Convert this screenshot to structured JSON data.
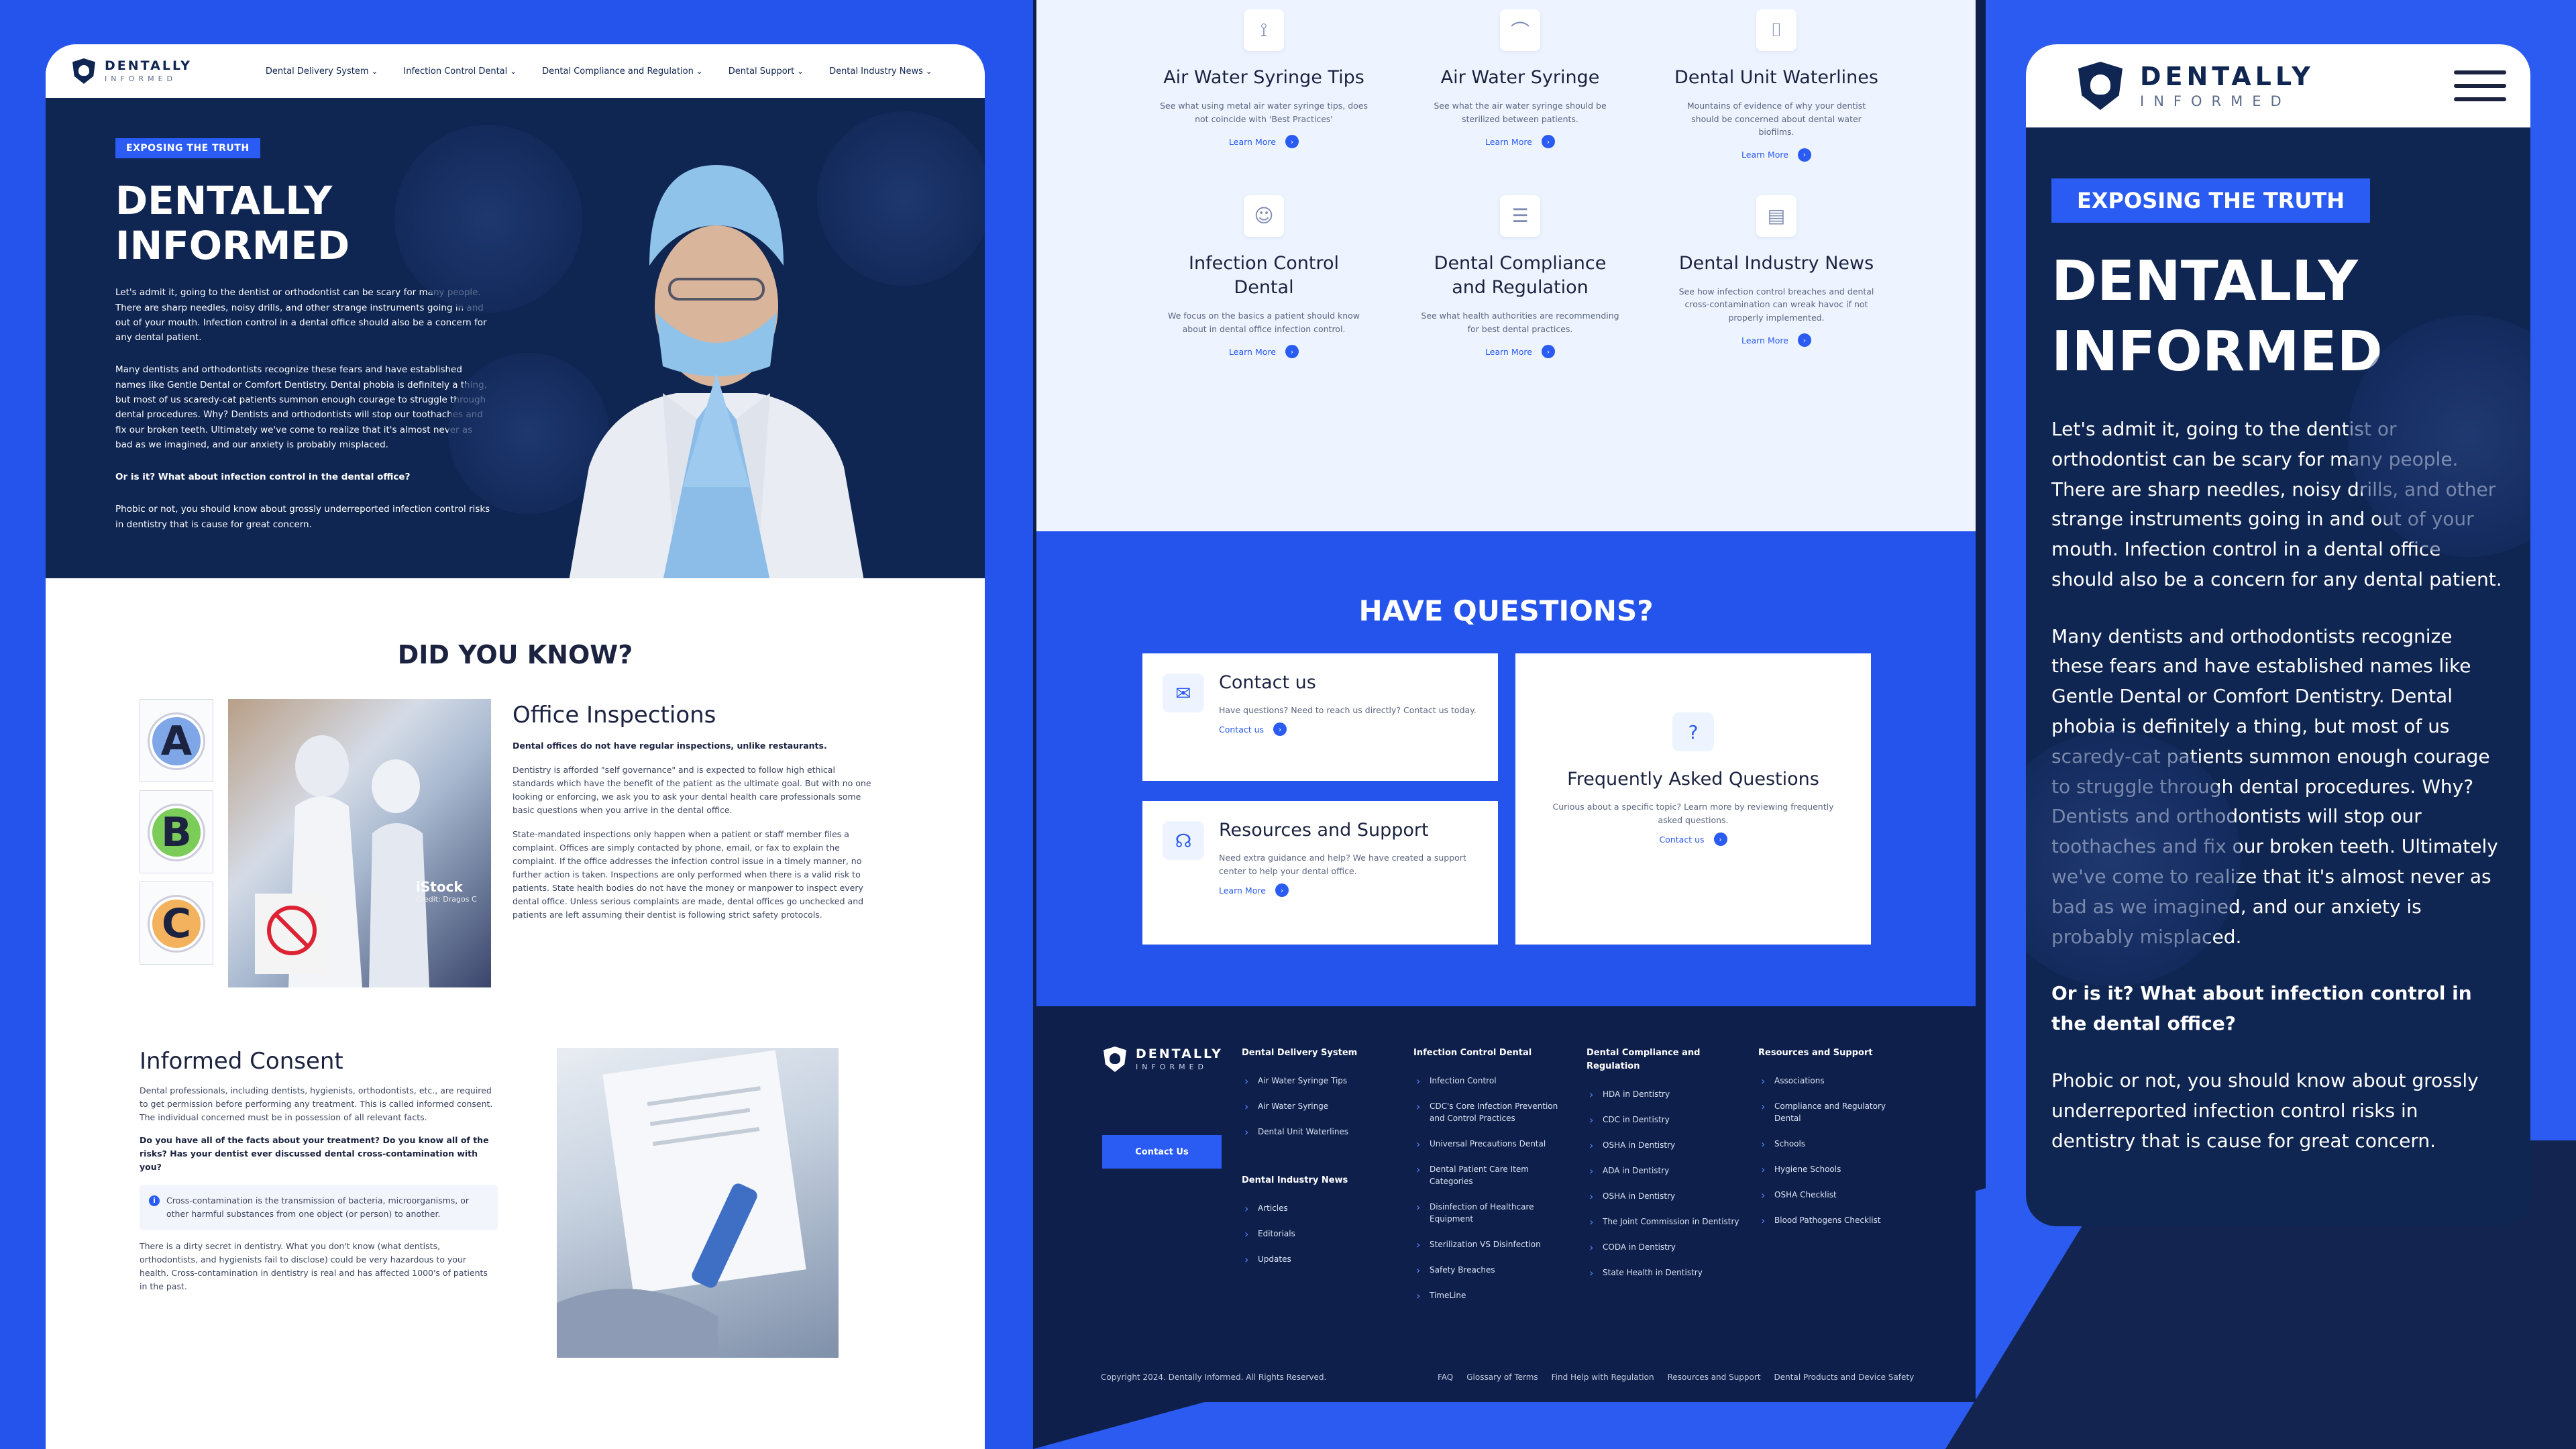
{
  "brand": {
    "name": "DENTALLY",
    "sub": "INFORMED"
  },
  "nav": {
    "items": [
      "Dental Delivery System",
      "Infection Control Dental",
      "Dental Compliance and Regulation",
      "Dental Support",
      "Dental Industry News"
    ]
  },
  "hero": {
    "tag": "EXPOSING THE TRUTH",
    "title_line1": "DENTALLY",
    "title_line2": "INFORMED",
    "p1": "Let's admit it, going to the dentist or orthodontist can be scary for many people. There are sharp needles, noisy drills, and other strange instruments going in and out of your mouth. Infection control in a dental office should also be a concern for any dental patient.",
    "p2": "Many dentists and orthodontists recognize these fears and have established names like Gentle Dental or Comfort Dentistry. Dental phobia is definitely a thing, but most of us scaredy-cat patients summon enough courage to struggle through dental procedures. Why? Dentists and orthodontists will stop our toothaches and fix our broken teeth. Ultimately we've come to realize that it's almost never as bad as we imagined, and our anxiety is probably misplaced.",
    "p3": "Or is it? What about infection control in the dental office?",
    "p4": "Phobic or not, you should know about grossly underreported infection control risks in dentistry that is cause for great concern."
  },
  "did_you_know": {
    "title": "DID YOU KNOW?",
    "grades": [
      "A",
      "B",
      "C"
    ],
    "photo_watermark": "iStock",
    "photo_credit": "Credit: Dragos C",
    "office": {
      "title": "Office Inspections",
      "lead": "Dental offices do not have regular inspections, unlike restaurants.",
      "p1": "Dentistry is afforded \"self governance\" and is expected to follow high ethical standards which have the benefit of the patient as the ultimate goal. But with no one looking or enforcing, we ask you to ask your dental health care professionals some basic questions when you arrive in the dental office.",
      "p2": "State-mandated inspections only happen when a patient or staff member files a complaint. Offices are simply contacted by phone, email, or fax to explain the complaint. If the office addresses the infection control issue in a timely manner, no further action is taken. Inspections are only performed when there is a valid risk to patients. State health bodies do not have the money or manpower to inspect every dental office. Unless serious complaints are made, dental offices go unchecked and patients are left assuming their dentist is following strict safety protocols."
    },
    "consent": {
      "title": "Informed Consent",
      "p1": "Dental professionals, including dentists, hygienists, orthodontists, etc., are required to get permission before performing any treatment. This is called informed consent. The individual concerned must be in possession of all relevant facts.",
      "q": "Do you have all of the facts about your treatment? Do you know all of the risks? Has your dentist ever discussed dental cross-contamination with you?",
      "callout": "Cross-contamination is the transmission of bacteria, microorganisms, or other harmful substances from one object (or person) to another.",
      "p2": "There is a dirty secret in dentistry. What you don't know (what dentists, orthodontists, and hygienists fail to disclose) could be very hazardous to your health. Cross-contamination in dentistry is real and has affected 1000's of patients in the past."
    }
  },
  "cards": [
    {
      "icon": "syringe-icon",
      "glyph": "⟟",
      "title": "Air Water Syringe Tips",
      "text": "See what using metal air water syringe tips, does not coincide with 'Best Practices'",
      "link": "Learn More"
    },
    {
      "icon": "syringe-hose-icon",
      "glyph": "⌒",
      "title": "Air Water Syringe",
      "text": "See what the air water syringe should be sterilized between patients.",
      "link": "Learn More"
    },
    {
      "icon": "water-bottle-icon",
      "glyph": "⌷",
      "title": "Dental Unit Waterlines",
      "text": "Mountains of evidence of why your dentist should be concerned about dental water biofilms.",
      "link": "Learn More"
    },
    {
      "icon": "dentist-icon",
      "glyph": "☺",
      "title": "Infection Control Dental",
      "text": "We focus on the basics a patient should know about in dental office infection control.",
      "link": "Learn More"
    },
    {
      "icon": "clipboard-icon",
      "glyph": "☰",
      "title": "Dental Compliance and Regulation",
      "text": "See what health authorities are recommending for best dental practices.",
      "link": "Learn More"
    },
    {
      "icon": "newspaper-icon",
      "glyph": "▤",
      "title": "Dental Industry News",
      "text": "See how infection control breaches and dental cross-contamination can wreak havoc if not properly implemented.",
      "link": "Learn More"
    }
  ],
  "questions": {
    "title": "HAVE QUESTIONS?",
    "contact": {
      "title": "Contact us",
      "text": "Have questions? Need to reach us directly? Contact us today.",
      "link": "Contact us"
    },
    "resources": {
      "title": "Resources and Support",
      "text": "Need extra guidance and help? We have created a support center to help your dental office.",
      "link": "Learn More"
    },
    "faq": {
      "title": "Frequently Asked Questions",
      "text": "Curious about a specific topic? Learn more by reviewing frequently asked questions.",
      "link": "Contact us"
    }
  },
  "footer": {
    "button": "Contact Us",
    "columns": [
      {
        "title": "Dental Delivery System",
        "items": [
          "Air Water Syringe Tips",
          "Air Water Syringe",
          "Dental Unit Waterlines"
        ]
      },
      {
        "title": "Dental Industry News",
        "items": [
          "Articles",
          "Editorials",
          "Updates"
        ]
      },
      {
        "title": "Infection Control Dental",
        "items": [
          "Infection Control",
          "CDC's Core Infection Prevention and Control Practices",
          "Universal Precautions Dental",
          "Dental Patient Care Item Categories",
          "Disinfection of Healthcare Equipment",
          "Sterilization VS Disinfection",
          "Safety Breaches",
          "TimeLine"
        ]
      },
      {
        "title": "Dental Compliance and Regulation",
        "items": [
          "HDA in Dentistry",
          "CDC in Dentistry",
          "OSHA in Dentistry",
          "ADA in Dentistry",
          "OSHA in Dentistry",
          "The Joint Commission in Dentistry",
          "CODA in Dentistry",
          "State Health in Dentistry"
        ]
      },
      {
        "title": "Resources and Support",
        "items": [
          "Associations",
          "Compliance and Regulatory Dental",
          "Schools",
          "Hygiene Schools",
          "OSHA Checklist",
          "Blood Pathogens Checklist"
        ]
      }
    ],
    "copyright": "Copyright 2024. Dentally Informed. All Rights Reserved.",
    "links": [
      "FAQ",
      "Glossary of Terms",
      "Find Help with Regulation",
      "Resources and Support",
      "Dental Products and Device Safety"
    ]
  }
}
